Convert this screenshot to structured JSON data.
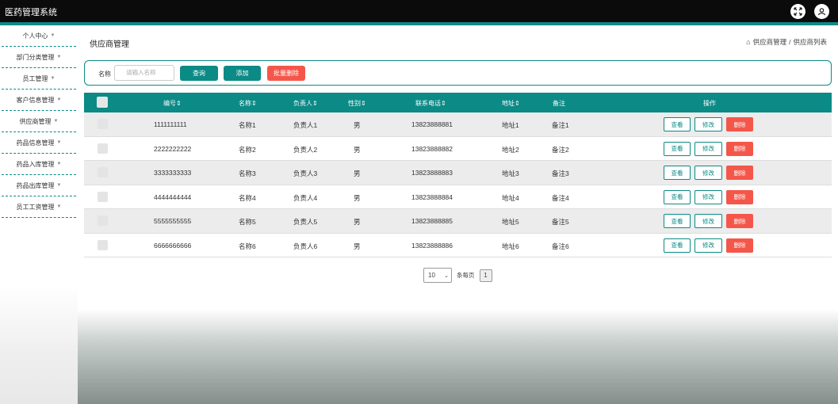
{
  "app": {
    "title": "医药管理系统"
  },
  "sidebar": {
    "items": [
      {
        "label": "个人中心"
      },
      {
        "label": "部门分类管理"
      },
      {
        "label": "员工管理"
      },
      {
        "label": "客户信息管理"
      },
      {
        "label": "供应商管理"
      },
      {
        "label": "药品信息管理"
      },
      {
        "label": "药品入库管理"
      },
      {
        "label": "药品出库管理"
      },
      {
        "label": "员工工资管理"
      }
    ]
  },
  "page": {
    "title": "供应商管理"
  },
  "breadcrumb": {
    "level1": "供应商管理",
    "separator": "/",
    "level2": "供应商列表"
  },
  "search": {
    "label": "名称",
    "placeholder": "请输入名称",
    "query_button": "查询",
    "add_button": "添加",
    "batch_delete_button": "批量删除"
  },
  "table": {
    "headers": {
      "id": "编号⇕",
      "name": "名称⇕",
      "contact": "负责人⇕",
      "gender": "性别⇕",
      "phone": "联系电话⇕",
      "address": "地址⇕",
      "remark": "备注",
      "actions": "操作"
    },
    "rows": [
      {
        "id": "1111111111",
        "name": "名称1",
        "contact": "负责人1",
        "gender": "男",
        "phone": "13823888881",
        "address": "地址1",
        "remark": "备注1"
      },
      {
        "id": "2222222222",
        "name": "名称2",
        "contact": "负责人2",
        "gender": "男",
        "phone": "13823888882",
        "address": "地址2",
        "remark": "备注2"
      },
      {
        "id": "3333333333",
        "name": "名称3",
        "contact": "负责人3",
        "gender": "男",
        "phone": "13823888883",
        "address": "地址3",
        "remark": "备注3"
      },
      {
        "id": "4444444444",
        "name": "名称4",
        "contact": "负责人4",
        "gender": "男",
        "phone": "13823888884",
        "address": "地址4",
        "remark": "备注4"
      },
      {
        "id": "5555555555",
        "name": "名称5",
        "contact": "负责人5",
        "gender": "男",
        "phone": "13823888885",
        "address": "地址5",
        "remark": "备注5"
      },
      {
        "id": "6666666666",
        "name": "名称6",
        "contact": "负责人6",
        "gender": "男",
        "phone": "13823888886",
        "address": "地址6",
        "remark": "备注6"
      }
    ],
    "row_actions": {
      "view": "查看",
      "edit": "修改",
      "delete": "删除"
    }
  },
  "pagination": {
    "page_size": "10",
    "per_page_label": "条每页",
    "current_page": "1"
  },
  "colors": {
    "accent": "#0b8a86",
    "danger": "#f4574a",
    "topbar": "#0b0b0b"
  }
}
